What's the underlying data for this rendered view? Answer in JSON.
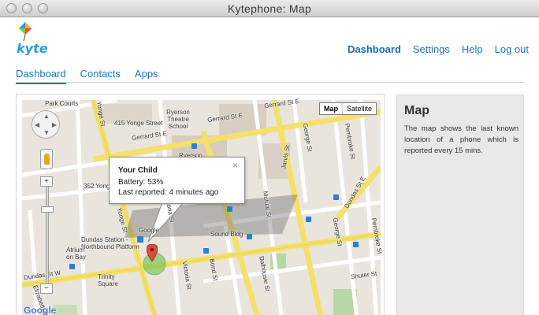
{
  "window": {
    "title": "Kytephone: Map"
  },
  "brand": {
    "logo_text": "kyte",
    "accent": "#1f77b8"
  },
  "topnav": {
    "items": [
      {
        "label": "Dashboard",
        "active": true
      },
      {
        "label": "Settings",
        "active": false
      },
      {
        "label": "Help",
        "active": false
      },
      {
        "label": "Log out",
        "active": false
      }
    ]
  },
  "tabs": [
    {
      "label": "Dashboard",
      "active": true
    },
    {
      "label": "Contacts",
      "active": false
    },
    {
      "label": "Apps",
      "active": false
    }
  ],
  "map": {
    "type_buttons": [
      "Map",
      "Satellite"
    ],
    "selected_type": "Map",
    "provider": "Google",
    "streets": [
      "Park Courts",
      "415 Yonge Street",
      "Ryerson Theatre School",
      "Gerrard St E",
      "Gerrard St E",
      "Gerrard St E",
      "Ryerson",
      "352 Yonge Street",
      "Dundas Station - Northbound Platform",
      "Atrium on Bay",
      "Trinity Square",
      "Dundas St W",
      "Google",
      "Sound Bldg",
      "Victoria St",
      "Victoria St",
      "Mutual St",
      "Dalhousie St",
      "Jarvis St",
      "George St",
      "George St",
      "Pembroke St",
      "Pembroke St",
      "Shuter St",
      "Bond St",
      "Yonge St",
      "Yonge St",
      "Elizabeth St",
      "Dundas St E"
    ],
    "popup": {
      "title": "Your Child",
      "battery": "Battery: 53%",
      "last_reported": "Last reported: 4 minutes ago",
      "close": "×"
    },
    "zoom_in": "+",
    "zoom_out": "−"
  },
  "sidebar": {
    "title": "Map",
    "description": "The map shows the last known location of a phone which is reported every 15 mins."
  }
}
